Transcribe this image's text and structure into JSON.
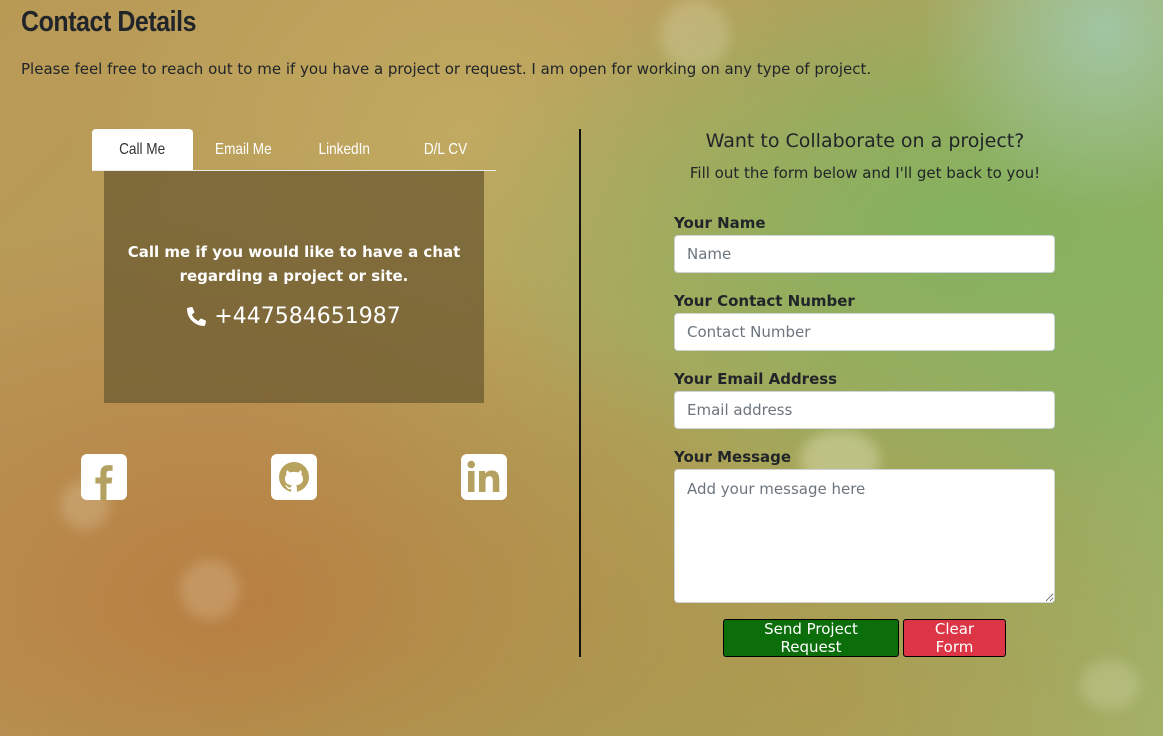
{
  "header": {
    "title": "Contact Details",
    "intro": "Please feel free to reach out to me if you have a project or request. I am open for working on any type of project."
  },
  "tabs": [
    {
      "label": "Call Me",
      "active": true
    },
    {
      "label": "Email Me",
      "active": false
    },
    {
      "label": "LinkedIn",
      "active": false
    },
    {
      "label": "D/L CV",
      "active": false
    }
  ],
  "call_panel": {
    "text": "Call me if you would like to have a chat regarding a project or site.",
    "phone": "+447584651987",
    "icon": "phone-icon"
  },
  "social": [
    {
      "name": "facebook-icon"
    },
    {
      "name": "github-icon"
    },
    {
      "name": "linkedin-icon"
    }
  ],
  "form": {
    "title": "Want to Collaborate on a project?",
    "subtitle": "Fill out the form below and I'll get back to you!",
    "fields": {
      "name": {
        "label": "Your Name",
        "placeholder": "Name",
        "value": ""
      },
      "contact": {
        "label": "Your Contact Number",
        "placeholder": "Contact Number",
        "value": ""
      },
      "email": {
        "label": "Your Email Address",
        "placeholder": "Email address",
        "value": ""
      },
      "message": {
        "label": "Your Message",
        "placeholder": "Add your message here",
        "value": ""
      }
    },
    "send_label": "Send Project Request",
    "clear_label": "Clear Form"
  },
  "colors": {
    "send_button": "#0b6e0b",
    "clear_button": "#dc3545",
    "panel": "#6e5c32"
  }
}
